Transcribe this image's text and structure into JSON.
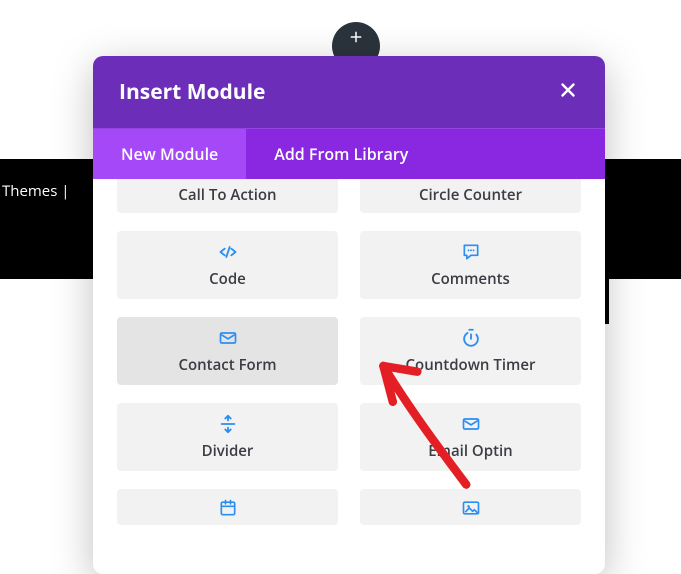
{
  "modal_title": "Insert Module",
  "tabs": {
    "new": "New Module",
    "library": "Add From Library"
  },
  "background_text": "Themes | ",
  "icon_color": "#2a8ef3",
  "arrow_color": "#e31e24",
  "modules": {
    "call_to_action": "Call To Action",
    "circle_counter": "Circle Counter",
    "code": "Code",
    "comments": "Comments",
    "contact_form": "Contact Form",
    "countdown_timer": "Countdown Timer",
    "divider": "Divider",
    "email_optin": "Email Optin"
  }
}
